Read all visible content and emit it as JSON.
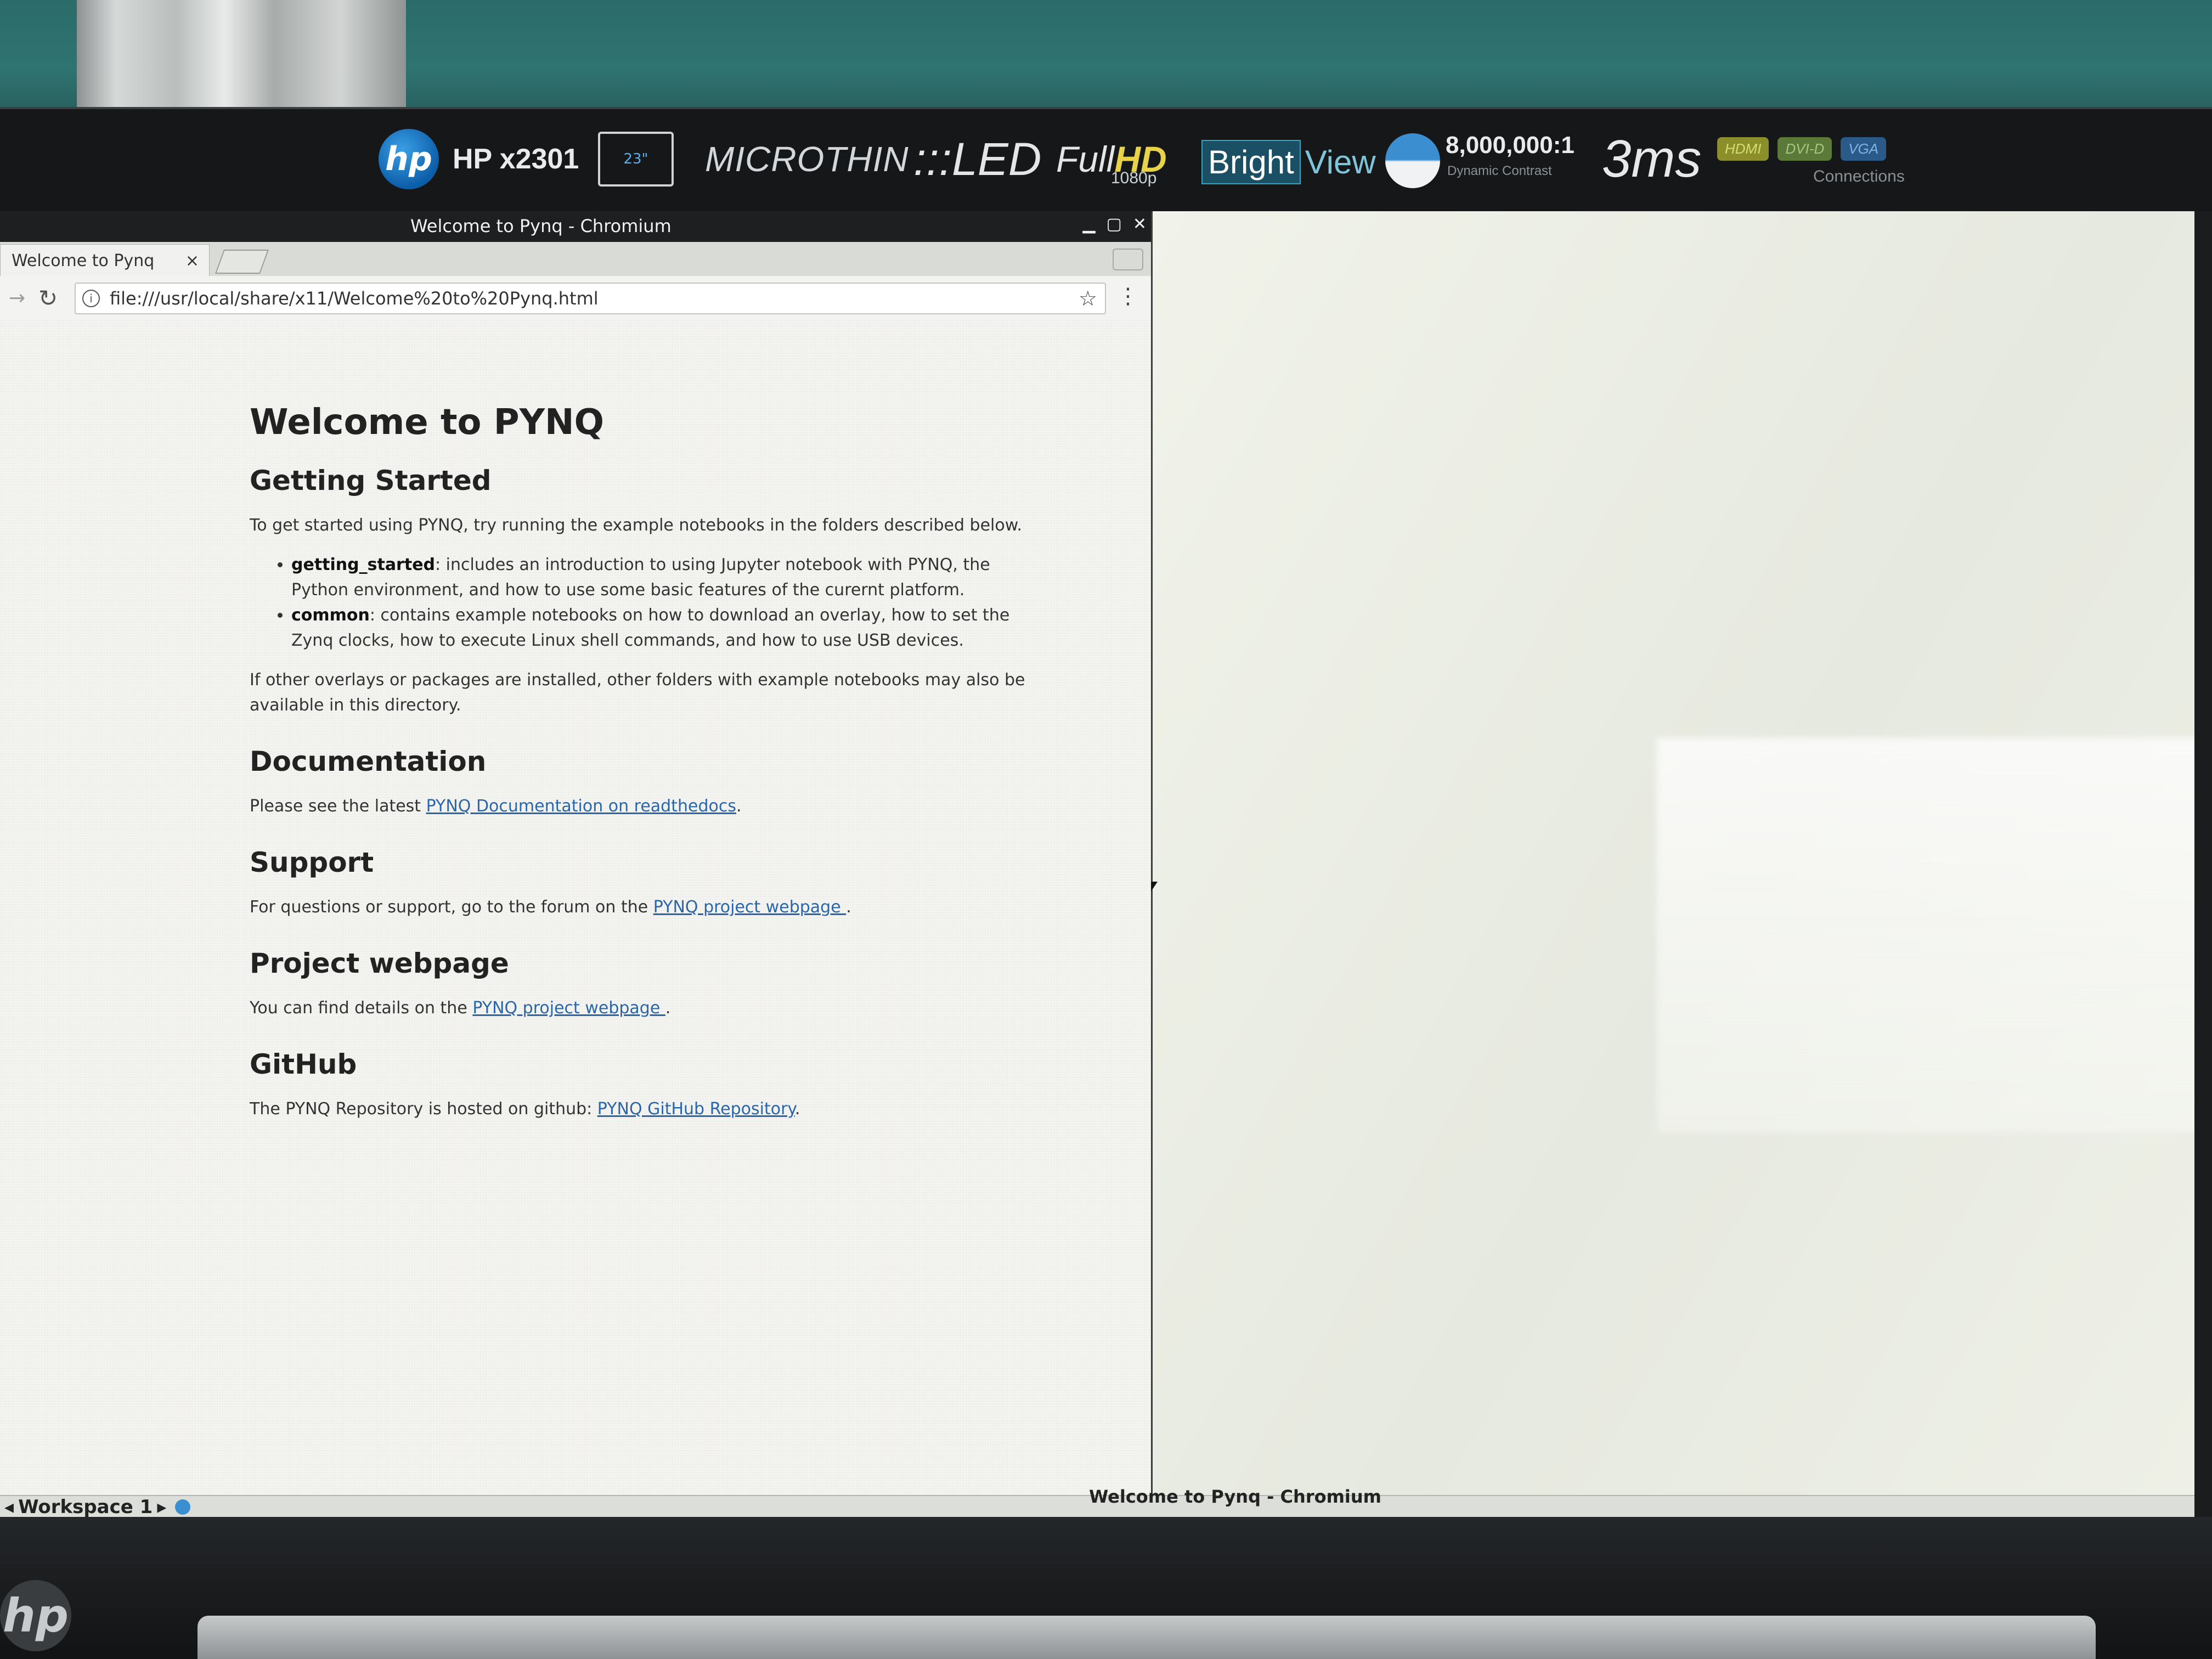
{
  "monitor": {
    "logo": "hp",
    "model": "HP x2301",
    "size_badge": "23\"",
    "micro": "MICROTHIN",
    "led": ":::LED",
    "fullhd_full": "Full",
    "fullhd_hd": "HD",
    "resolution": "1080p",
    "bright": "Bright",
    "view": "View",
    "contrast": "8,000,000:1",
    "contrast_sub": "Dynamic Contrast",
    "response": "3ms",
    "ports": [
      "HDMI",
      "DVI-D",
      "VGA"
    ],
    "connections": "Connections",
    "bottom_logo": "hp"
  },
  "window": {
    "title": "Welcome to Pynq - Chromium",
    "controls": [
      "minimize-icon",
      "maximize-icon",
      "close-icon"
    ]
  },
  "browser": {
    "tab_label": "Welcome to Pynq",
    "tab_close": "×",
    "url": "file:///usr/local/share/x11/Welcome%20to%20Pynq.html",
    "star": "☆",
    "menu": "⋮",
    "reload": "↻",
    "forward": "→",
    "info": "i"
  },
  "page": {
    "title": "Welcome to PYNQ",
    "getting_started": {
      "heading": "Getting Started",
      "intro": "To get started using PYNQ, try running the example notebooks in the folders described below.",
      "items": [
        {
          "term": "getting_started",
          "text": ": includes an introduction to using Jupyter notebook with PYNQ, the Python environment, and how to use some basic features of the curernt platform."
        },
        {
          "term": "common",
          "text": ": contains example notebooks on how to download an overlay, how to set the Zynq clocks, how to execute Linux shell commands, and how to use USB devices."
        }
      ],
      "outro": "If other overlays or packages are installed, other folders with example notebooks may also be available in this directory."
    },
    "documentation": {
      "heading": "Documentation",
      "text_before": "Please see the latest ",
      "link": "PYNQ Documentation on readthedocs",
      "text_after": "."
    },
    "support": {
      "heading": "Support",
      "text_before": "For questions or support, go to the forum on the ",
      "link": "PYNQ project webpage ",
      "text_after": "."
    },
    "project": {
      "heading": "Project webpage",
      "text_before": "You can find details on the ",
      "link": "PYNQ project webpage ",
      "text_after": "."
    },
    "github": {
      "heading": "GitHub",
      "text_before": "The PYNQ Repository is hosted on github: ",
      "link": "PYNQ GitHub Repository",
      "text_after": "."
    }
  },
  "taskbar": {
    "workspace": "Workspace 1",
    "prev": "◂",
    "next": "▸",
    "task_title": "Welcome to Pynq - Chromium"
  }
}
